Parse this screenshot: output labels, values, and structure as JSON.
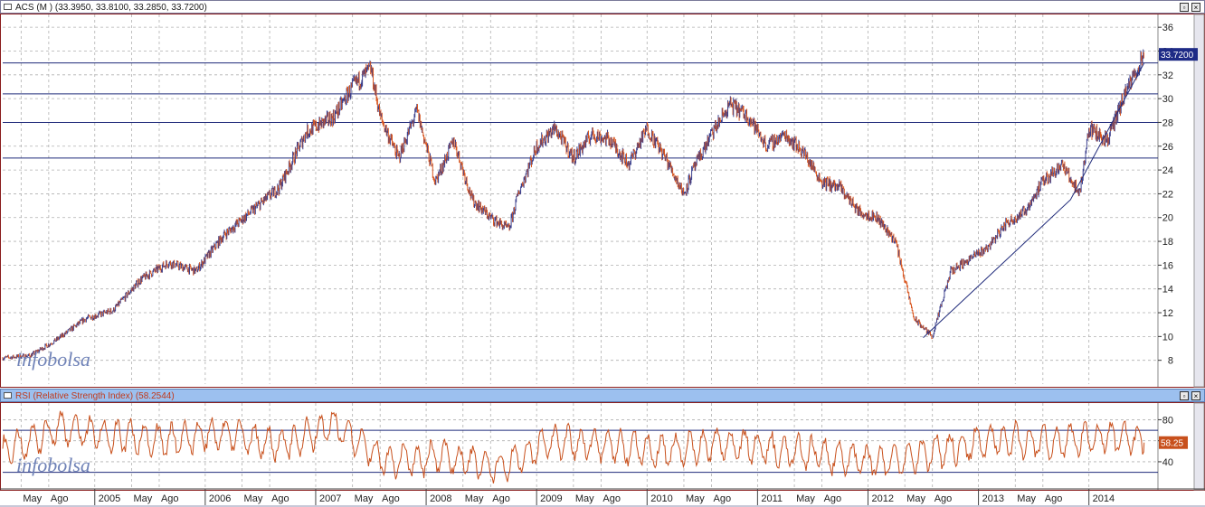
{
  "price_pane": {
    "title": "ACS (M ) (33.3950, 33.8100, 33.2850, 33.7200)",
    "last_label": "33.7200",
    "watermark": "infobolsa"
  },
  "rsi_pane": {
    "title": "RSI (Relative Strength Index) (58.2544)",
    "last_label": "58.25",
    "watermark": "infobolsa"
  },
  "window_buttons": {
    "restore": "▫",
    "close": "×"
  },
  "colors": {
    "up": "#3b3f8c",
    "down": "#d9561f",
    "rsi_line": "#c8501c",
    "level_line": "#1f2a7a",
    "trend_line": "#1f2a7a",
    "grid": "#b0b0b0",
    "rsi_bar": "#9cc0ef",
    "last_box": "#1e2b86"
  },
  "chart_data": [
    {
      "type": "line",
      "title": "ACS (M ) (33.3950, 33.8100, 33.2850, 33.7200)",
      "xlabel": "",
      "ylabel": "",
      "ylim": [
        6,
        37
      ],
      "yticks": [
        8,
        10,
        12,
        14,
        16,
        18,
        20,
        22,
        24,
        26,
        28,
        30,
        32,
        34,
        36
      ],
      "grid": true,
      "x_tick_labels": [
        "May",
        "Ago",
        "2005",
        "May",
        "Ago",
        "2006",
        "May",
        "Ago",
        "2007",
        "May",
        "Ago",
        "2008",
        "May",
        "Ago",
        "2009",
        "May",
        "Ago",
        "2010",
        "May",
        "Ago",
        "2011",
        "May",
        "Ago",
        "2012",
        "May",
        "Ago",
        "2013",
        "May",
        "Ago",
        "2014"
      ],
      "x_tick_dates": [
        "2004-05",
        "2004-08",
        "2005-01",
        "2005-05",
        "2005-08",
        "2006-01",
        "2006-05",
        "2006-08",
        "2007-01",
        "2007-05",
        "2007-08",
        "2008-01",
        "2008-05",
        "2008-08",
        "2009-01",
        "2009-05",
        "2009-08",
        "2010-01",
        "2010-05",
        "2010-08",
        "2011-01",
        "2011-05",
        "2011-08",
        "2012-01",
        "2012-05",
        "2012-08",
        "2013-01",
        "2013-05",
        "2013-08",
        "2014-01"
      ],
      "series": [
        {
          "x": [
            "2004-03",
            "2004-06",
            "2004-09",
            "2004-12",
            "2005-03",
            "2005-06",
            "2005-09",
            "2005-12",
            "2006-03",
            "2006-06",
            "2006-09",
            "2006-12",
            "2007-03",
            "2007-05",
            "2007-07",
            "2007-08",
            "2007-10",
            "2007-12",
            "2008-02",
            "2008-04",
            "2008-06",
            "2008-08",
            "2008-10",
            "2008-11",
            "2009-01",
            "2009-03",
            "2009-05",
            "2009-07",
            "2009-09",
            "2009-11",
            "2010-01",
            "2010-03",
            "2010-05",
            "2010-06",
            "2010-08",
            "2010-10",
            "2010-12",
            "2011-02",
            "2011-04",
            "2011-06",
            "2011-08",
            "2011-10",
            "2011-12",
            "2012-02",
            "2012-04",
            "2012-06",
            "2012-08",
            "2012-10",
            "2012-12",
            "2013-02",
            "2013-04",
            "2013-06",
            "2013-08",
            "2013-10",
            "2013-12",
            "2014-01",
            "2014-03",
            "2014-05",
            "2014-07"
          ],
          "y": [
            8.2,
            8.4,
            9.8,
            11.5,
            12.2,
            14.8,
            16.2,
            15.5,
            18.5,
            20.5,
            22.5,
            27.2,
            28.5,
            31.0,
            32.5,
            28.5,
            25.0,
            29.0,
            23.0,
            26.5,
            21.5,
            20.0,
            19.0,
            22.0,
            26.0,
            27.5,
            25.0,
            27.0,
            26.5,
            24.5,
            27.5,
            25.0,
            22.0,
            24.0,
            27.0,
            29.5,
            28.5,
            26.0,
            27.0,
            25.5,
            23.0,
            22.5,
            20.5,
            20.0,
            18.0,
            11.5,
            10.0,
            15.5,
            16.5,
            17.5,
            19.5,
            20.5,
            23.0,
            24.5,
            22.0,
            27.5,
            26.5,
            30.5,
            33.72
          ]
        }
      ],
      "horizontal_levels": [
        33.0,
        30.4,
        28.0,
        25.0
      ],
      "trendline": [
        {
          "x": "2012-07",
          "y": 9.9
        },
        {
          "x": "2013-11",
          "y": 21.5
        },
        {
          "x": "2014-07",
          "y": 33.0
        }
      ],
      "last_value": 33.72
    },
    {
      "type": "line",
      "title": "RSI (Relative Strength Index) (58.2544)",
      "ylim": [
        15,
        95
      ],
      "yticks": [
        40,
        60,
        80
      ],
      "levels": [
        70,
        30
      ],
      "grid": true,
      "series": [
        {
          "name": "RSI",
          "x": [
            "2004-03",
            "2004-09",
            "2005-03",
            "2005-09",
            "2006-03",
            "2006-09",
            "2007-03",
            "2007-09",
            "2008-03",
            "2008-09",
            "2009-03",
            "2009-09",
            "2010-03",
            "2010-09",
            "2011-03",
            "2011-09",
            "2012-03",
            "2012-09",
            "2013-03",
            "2013-09",
            "2014-03",
            "2014-07"
          ],
          "y": [
            48,
            72,
            65,
            60,
            68,
            55,
            75,
            40,
            45,
            35,
            60,
            55,
            50,
            58,
            52,
            45,
            40,
            50,
            62,
            58,
            65,
            58.25
          ]
        }
      ],
      "last_value": 58.25
    }
  ]
}
